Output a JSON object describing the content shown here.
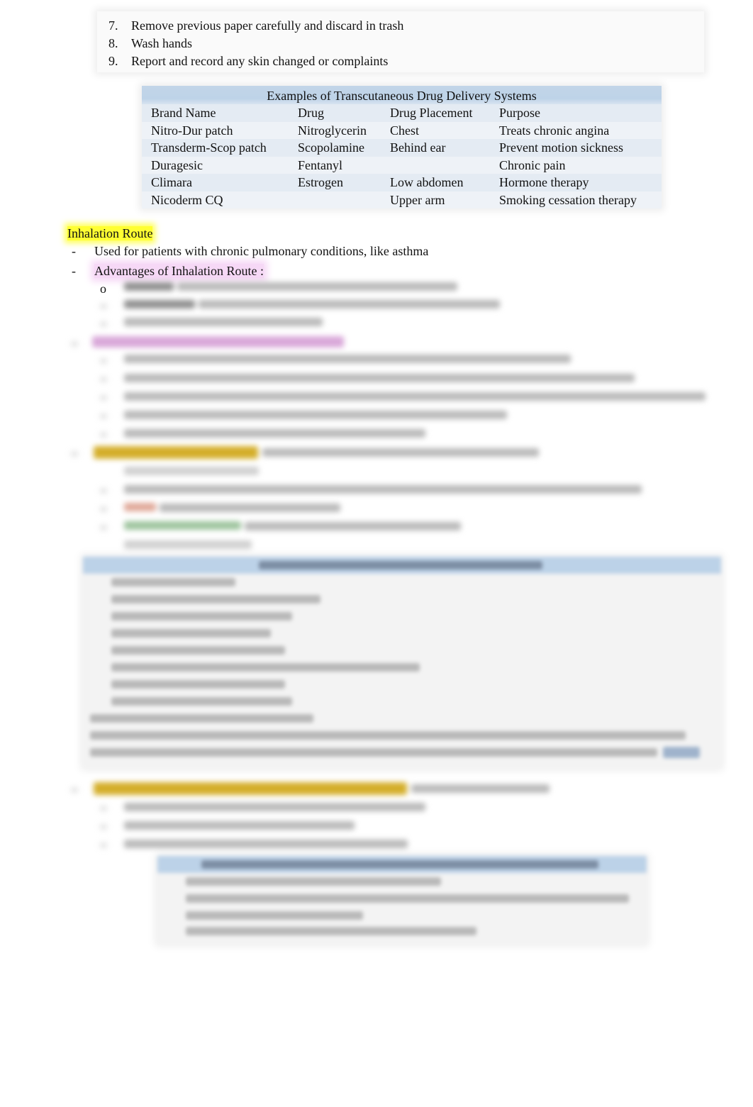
{
  "steps_continued": [
    {
      "num": "7.",
      "text": "Remove previous paper carefully and discard in trash"
    },
    {
      "num": "8.",
      "text": "Wash hands"
    },
    {
      "num": "9.",
      "text": "Report and record any skin changed or complaints"
    }
  ],
  "transcutaneous_table": {
    "title": "Examples of Transcutaneous Drug Delivery Systems",
    "header": [
      "Brand Name",
      "Drug",
      "Drug Placement",
      "Purpose"
    ],
    "rows": [
      [
        "Nitro-Dur patch",
        "Nitroglycerin",
        "Chest",
        "Treats chronic angina"
      ],
      [
        "Transderm-Scop patch",
        "Scopolamine",
        "Behind ear",
        "Prevent motion sickness"
      ],
      [
        "Duragesic",
        "Fentanyl",
        "",
        "Chronic pain"
      ],
      [
        "Climara",
        "Estrogen",
        "Low abdomen",
        "Hormone therapy"
      ],
      [
        "Nicoderm CQ",
        "",
        "Upper arm",
        "Smoking cessation therapy"
      ]
    ],
    "colors": {
      "title_bg": "#bed3e8",
      "row_bg_a": "#e4ebf3",
      "row_bg_b": "#eef2f7"
    }
  },
  "inhalation": {
    "heading": "Inhalation Route",
    "heading_highlight": "#ffff33",
    "bullets": [
      {
        "marker": "-",
        "text": "Used for patients with chronic pulmonary conditions, like asthma"
      },
      {
        "marker": "-",
        "text": "Advantages of Inhalation Route :",
        "highlight": "#f6d8f6"
      }
    ],
    "sub_marker": "o"
  },
  "blurred_content_note": "Remaining content is blurred / unreadable",
  "highlight_colors": {
    "purple": "#d9a8d9",
    "gold": "#d4ae2a",
    "salmon": "#e0a898",
    "green": "#9cc39c",
    "table_header_blue": "#bcd2e8"
  }
}
